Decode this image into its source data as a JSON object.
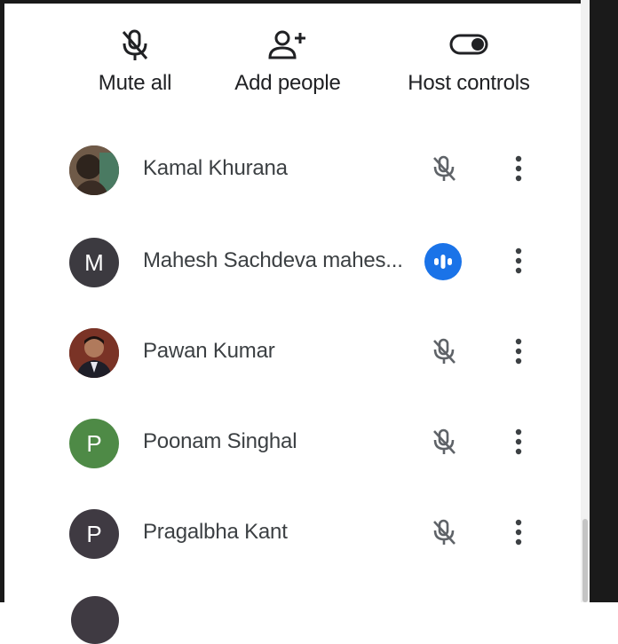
{
  "actions": [
    {
      "label": "Mute all",
      "icon": "mic-off-icon"
    },
    {
      "label": "Add people",
      "icon": "person-add-icon"
    },
    {
      "label": "Host controls",
      "icon": "toggle-icon"
    }
  ],
  "participants": [
    {
      "name": "Kamal Khurana",
      "avatar": "photo",
      "mic": "muted"
    },
    {
      "name": "Mahesh Sachdeva mahes...",
      "avatar": "M",
      "avatar_color": "#3c3a40",
      "mic": "speaking"
    },
    {
      "name": "Pawan Kumar",
      "avatar": "photo",
      "mic": "muted"
    },
    {
      "name": "Poonam Singhal",
      "avatar": "P",
      "avatar_color": "#4e8a46",
      "mic": "muted"
    },
    {
      "name": "Pragalbha Kant",
      "avatar": "P",
      "avatar_color": "#3f3a42",
      "mic": "muted"
    }
  ],
  "colors": {
    "speaking_indicator": "#1a73e8",
    "text": "#3c4043"
  }
}
